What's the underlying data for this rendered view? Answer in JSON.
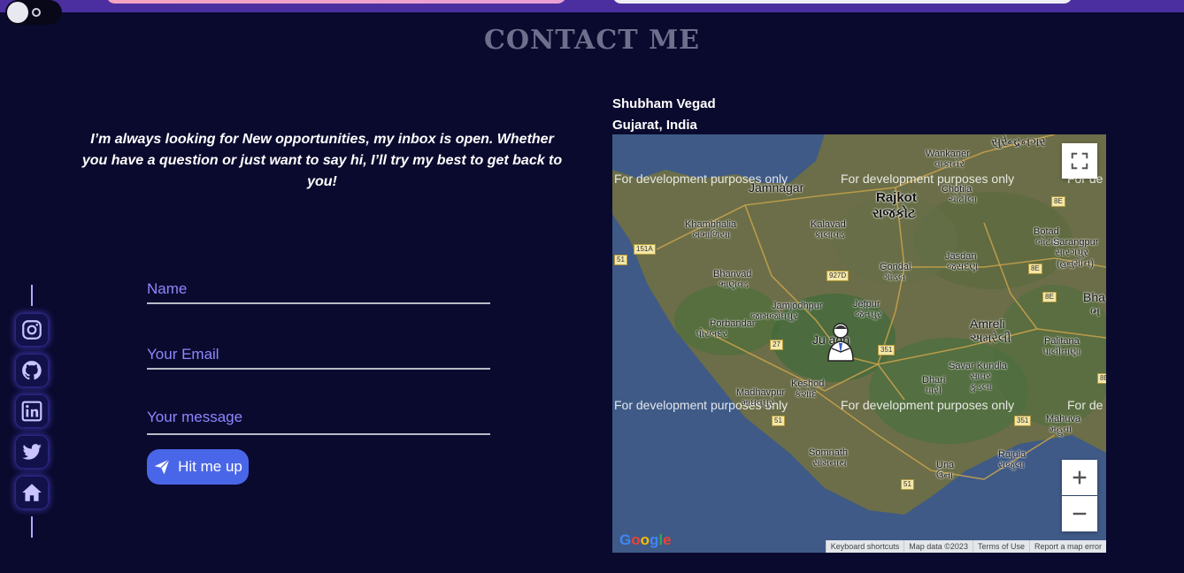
{
  "topbar": {
    "theme_toggle": "theme-toggle"
  },
  "section": {
    "title": "CONTACT ME"
  },
  "intro": {
    "text": "I’m always looking for New opportunities, my inbox is open. Whether you have a question or just want to say hi, I’ll try my best to get back to you!"
  },
  "form": {
    "name_placeholder": "Name",
    "email_placeholder": "Your Email",
    "message_placeholder": "Your message",
    "submit_label": "Hit me up"
  },
  "social": {
    "items": [
      {
        "name": "instagram",
        "icon": "instagram-icon"
      },
      {
        "name": "github",
        "icon": "github-icon"
      },
      {
        "name": "linkedin",
        "icon": "linkedin-icon"
      },
      {
        "name": "twitter",
        "icon": "twitter-icon"
      },
      {
        "name": "home",
        "icon": "home-icon"
      }
    ]
  },
  "map": {
    "owner_name": "Shubham Vegad",
    "owner_location": "Gujarat, India",
    "dev_watermark": "For development purposes only",
    "dev_watermark_cut": "For de",
    "labels": {
      "surendranagar": "સુરેન્દ્રનગર",
      "wankaner": "Wankaner",
      "wankaner_g": "વાંકાનેર",
      "jamnagar": "Jamnagar",
      "rajkot": "Rajkot",
      "rajkot_g": "રાજકોટ",
      "chotila": "Chotila",
      "chotila_g": "ચોટીલા",
      "khambhalia": "Khambhalia",
      "khambhalia_g": "ખંભાળિયા",
      "kalavad": "Kalavad",
      "kalavad_g": "કાલાવડ",
      "botad": "Botad",
      "botad_g": "બોટાદ",
      "sarangpur": "Sarangpur",
      "sarangpur_g": "સારંગપુર",
      "sarangpur_g2": "(હનુમાન)",
      "bhanvad": "Bhanvad",
      "bhanvad_g": "ભાણવડ",
      "gondal": "Gondal",
      "gondal_g": "ગોંડલ",
      "jasdan": "Jasdan",
      "jasdan_g": "જસદણ",
      "jamjodhpur": "Jamjodhpur",
      "jamjodhpur_g": "જામજોધપુર",
      "jetpur": "Jetpur",
      "jetpur_g": "જેતપુર",
      "bha": "Bha",
      "bha_g": "ભ",
      "porbandar": "Porbandar",
      "porbandar_g": "પોરબંદર",
      "amreli": "Amreli",
      "amreli_g": "અમરેલી",
      "junagadh": "Ju    adh",
      "palitana": "Palitana",
      "palitana_g": "પાલીતાણા",
      "savar_kundla": "Savar Kundla",
      "savar_kundla_g": "સાવર",
      "savar_kundla_g2": "કુંડલા",
      "keshod": "Keshod",
      "keshod_g": "કેશોદ",
      "dhari": "Dhari",
      "dhari_g": "ધારી",
      "madhavpur": "Madhavpur",
      "madhavpur_g": "માધવપુર",
      "mahuva": "Mahuva",
      "mahuva_g": "મહુવા",
      "somnath": "Somnath",
      "somnath_g": "સોમનાથ",
      "una": "Una",
      "una_g": "ઉના",
      "rajula": "Rajula",
      "rajula_g": "રાજુલા"
    },
    "shields": [
      "151A",
      "51",
      "927D",
      "8E",
      "8E",
      "8E",
      "27",
      "351",
      "51",
      "351",
      "51",
      "8E"
    ],
    "attribution": {
      "keyboard": "Keyboard shortcuts",
      "data": "Map data ©2023",
      "terms": "Terms of Use",
      "report": "Report a map error"
    },
    "logo": "Google"
  },
  "colors": {
    "background": "#0a0a2e",
    "accent": "#4a66e8",
    "placeholder": "#8f86ff",
    "title": "#6d6f8c"
  }
}
